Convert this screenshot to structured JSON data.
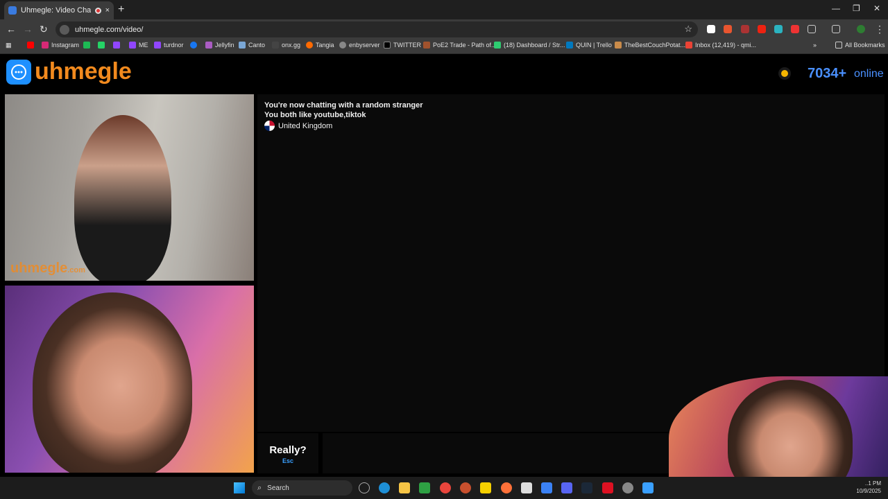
{
  "browser": {
    "tab_title": "Uhmegle: Video Chat | Ome",
    "tab_close": "×",
    "new_tab": "+",
    "url": "uhmegle.com/video/",
    "all_bookmarks": "All Bookmarks"
  },
  "bookmarks": [
    {
      "label": "Instagram",
      "color": "#d62976"
    },
    {
      "label": "",
      "color": "#1db954"
    },
    {
      "label": "",
      "color": "#25d366"
    },
    {
      "label": "",
      "color": "#9146ff"
    },
    {
      "label": "ME",
      "color": "#9146ff"
    },
    {
      "label": "turdnor",
      "color": "#9146ff"
    },
    {
      "label": "",
      "color": "#1877f2"
    },
    {
      "label": "Jellyfin",
      "color": "#aa5cc3"
    },
    {
      "label": "Canto",
      "color": "#7aa7d6"
    },
    {
      "label": "onx.gg",
      "color": "#444"
    },
    {
      "label": "Tangia",
      "color": "#ff6a00"
    },
    {
      "label": "enbyserver",
      "color": "#888"
    },
    {
      "label": "TWITTER",
      "color": "#000"
    },
    {
      "label": "PoE2 Trade - Path of...",
      "color": "#a0522d"
    },
    {
      "label": "(18) Dashboard / Str...",
      "color": "#2ecc71"
    },
    {
      "label": "QUIN | Trello",
      "color": "#0079bf"
    },
    {
      "label": "TheBestCouchPotat...",
      "color": "#c98b4a"
    },
    {
      "label": "Inbox (12,419) - qmi...",
      "color": "#ea4335"
    }
  ],
  "site": {
    "logo_text": "uhmegle",
    "online_count": "7034+",
    "online_label": "online",
    "watermark": "uhmegle",
    "watermark_suffix": ".com"
  },
  "chat": {
    "line1": "You're now chatting with a random stranger",
    "line2": "You both like youtube,tiktok",
    "country": "United Kingdom",
    "stop_label": "Really?",
    "stop_hint": "Esc"
  },
  "taskbar": {
    "search_label": "Search",
    "time": "..1 PM",
    "date": "10/9/2025"
  }
}
